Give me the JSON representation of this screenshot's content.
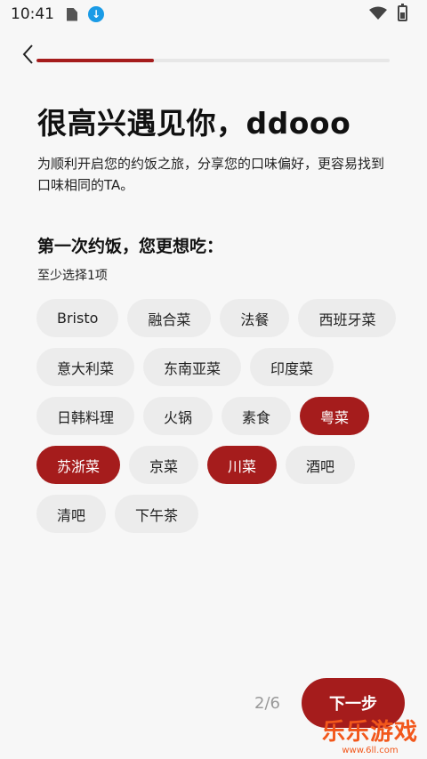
{
  "status_bar": {
    "time": "10:41",
    "download_icon": "download-icon",
    "wifi_icon": "wifi-icon",
    "battery_icon": "battery-charging-icon"
  },
  "nav": {
    "back_icon": "chevron-left-icon",
    "progress_fraction": 0.333
  },
  "header": {
    "title": "很高兴遇见你，ddooo",
    "subtitle": "为顺利开启您的约饭之旅，分享您的口味偏好，更容易找到口味相同的TA。"
  },
  "question": {
    "title": "第一次约饭，您更想吃：",
    "hint": "至少选择1项"
  },
  "tags": [
    {
      "label": "Bristo",
      "selected": false
    },
    {
      "label": "融合菜",
      "selected": false
    },
    {
      "label": "法餐",
      "selected": false
    },
    {
      "label": "西班牙菜",
      "selected": false
    },
    {
      "label": "意大利菜",
      "selected": false
    },
    {
      "label": "东南亚菜",
      "selected": false
    },
    {
      "label": "印度菜",
      "selected": false
    },
    {
      "label": "日韩料理",
      "selected": false
    },
    {
      "label": "火锅",
      "selected": false
    },
    {
      "label": "素食",
      "selected": false
    },
    {
      "label": "粤菜",
      "selected": true
    },
    {
      "label": "苏浙菜",
      "selected": true
    },
    {
      "label": "京菜",
      "selected": false
    },
    {
      "label": "川菜",
      "selected": true
    },
    {
      "label": "酒吧",
      "selected": false
    },
    {
      "label": "清吧",
      "selected": false
    },
    {
      "label": "下午茶",
      "selected": false
    }
  ],
  "footer": {
    "page_counter": "2/6",
    "next_label": "下一步"
  },
  "watermark": {
    "name": "乐乐游戏",
    "url": "www.6ll.com"
  },
  "colors": {
    "accent": "#a51c1c",
    "tag_bg": "#ececec",
    "background": "#f7f7f7",
    "watermark": "#f2571b"
  }
}
